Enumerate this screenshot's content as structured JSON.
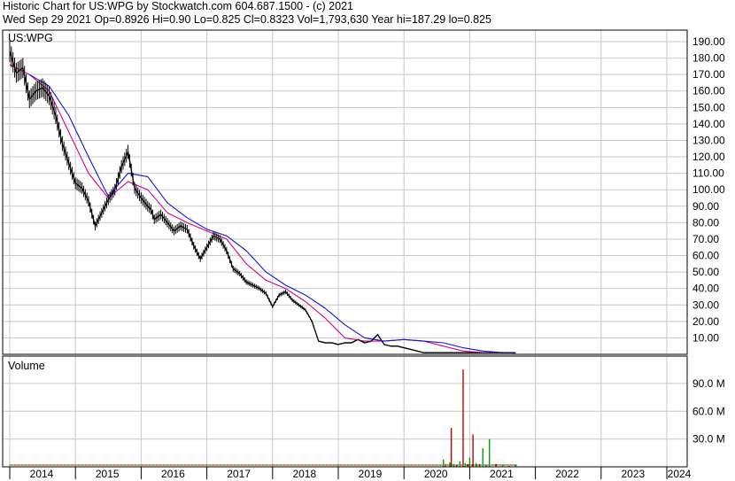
{
  "header": {
    "line1": "Historic Chart for US:WPG by Stockwatch.com 604.687.1500 - (c) 2021",
    "line2": "Wed Sep 29 2021   Op=0.8926   Hi=0.90   Lo=0.825   Cl=0.8323   Vol=1,793,630   Year hi=187.29   lo=0.825"
  },
  "chart_data": [
    {
      "type": "line",
      "title": "US:WPG",
      "ylim": [
        0,
        197
      ],
      "y_ticks": [
        "10.00",
        "20.00",
        "30.00",
        "40.00",
        "50.00",
        "60.00",
        "70.00",
        "80.00",
        "90.00",
        "100.00",
        "110.00",
        "120.00",
        "130.00",
        "140.00",
        "150.00",
        "160.00",
        "170.00",
        "180.00",
        "190.00"
      ],
      "x_tick_labels": [
        "2014",
        "2015",
        "2016",
        "2017",
        "2018",
        "2019",
        "2020",
        "2021",
        "2022",
        "2023",
        "2024"
      ],
      "grid": true,
      "series": [
        {
          "x": [
            2014.0,
            2014.1,
            2014.2,
            2014.3,
            2014.4,
            2014.5,
            2014.6,
            2014.7,
            2014.8,
            2014.9,
            2015.0,
            2015.1,
            2015.2,
            2015.3,
            2015.4,
            2015.5,
            2015.6,
            2015.7,
            2015.8,
            2015.9,
            2016.0,
            2016.1,
            2016.15,
            2016.2,
            2016.3,
            2016.4,
            2016.5,
            2016.6,
            2016.7,
            2016.8,
            2016.9,
            2017.0,
            2017.1,
            2017.2,
            2017.3,
            2017.4,
            2017.5,
            2017.6,
            2017.7,
            2017.8,
            2017.9,
            2018.0,
            2018.1,
            2018.2,
            2018.3,
            2018.4,
            2018.5,
            2018.6,
            2018.7,
            2018.8,
            2018.9,
            2019.0,
            2019.1,
            2019.2,
            2019.3,
            2019.4,
            2019.5,
            2019.6,
            2019.7,
            2019.8,
            2019.9,
            2020.0,
            2020.1,
            2020.2,
            2020.3,
            2020.4,
            2020.5,
            2020.6,
            2020.7,
            2020.8,
            2020.9,
            2021.0,
            2021.1,
            2021.2,
            2021.3,
            2021.4,
            2021.5,
            2021.6,
            2021.7
          ],
          "y": [
            184,
            171,
            174,
            155,
            160,
            162,
            157,
            145,
            128,
            116,
            104,
            101,
            93,
            78,
            86,
            94,
            100,
            114,
            123,
            101,
            95,
            90,
            88,
            82,
            85,
            80,
            75,
            78,
            76,
            66,
            58,
            65,
            72,
            70,
            63,
            52,
            49,
            44,
            42,
            40,
            37,
            29,
            36,
            38,
            33,
            30,
            27,
            20,
            8,
            7,
            7,
            6,
            7,
            7,
            9,
            7,
            8,
            12,
            6,
            5,
            5,
            4,
            3,
            2,
            1,
            1,
            1,
            1,
            1,
            1,
            1,
            1,
            1,
            1,
            1,
            1,
            1,
            1,
            0.83
          ]
        },
        {
          "x": [
            2014.0,
            2014.3,
            2014.6,
            2014.9,
            2015.2,
            2015.5,
            2015.8,
            2016.1,
            2016.4,
            2016.7,
            2017.0,
            2017.3,
            2017.6,
            2017.9,
            2018.2,
            2018.5,
            2018.8,
            2019.1,
            2019.4,
            2019.7,
            2020.0,
            2020.3,
            2020.6,
            2020.9,
            2021.2,
            2021.5,
            2021.7
          ],
          "y": [
            176,
            170,
            160,
            135,
            110,
            95,
            105,
            100,
            86,
            80,
            75,
            70,
            55,
            45,
            40,
            32,
            22,
            10,
            8,
            8,
            9,
            8,
            5,
            2,
            1,
            1,
            0.9
          ]
        },
        {
          "x": [
            2014.3,
            2014.6,
            2014.9,
            2015.2,
            2015.5,
            2015.8,
            2016.1,
            2016.4,
            2016.7,
            2017.0,
            2017.3,
            2017.6,
            2017.9,
            2018.2,
            2018.5,
            2018.8,
            2019.1,
            2019.4,
            2019.7,
            2020.0,
            2020.3,
            2020.6,
            2020.9,
            2021.2,
            2021.5,
            2021.7
          ],
          "y": [
            170,
            163,
            145,
            120,
            96,
            110,
            108,
            92,
            83,
            76,
            72,
            63,
            50,
            42,
            36,
            28,
            18,
            10,
            8,
            9,
            8,
            7,
            4,
            2,
            1,
            1
          ]
        }
      ]
    },
    {
      "type": "bar",
      "title": "Volume",
      "ylim": [
        0,
        110
      ],
      "y_ticks": [
        "30.0 M",
        "60.0 M",
        "90.0 M"
      ],
      "series": [
        {
          "x": [
            2020.6,
            2020.63,
            2020.7,
            2020.72,
            2020.76,
            2020.8,
            2020.85,
            2020.9,
            2020.93,
            2020.97,
            2021.0,
            2021.05,
            2021.1,
            2021.15,
            2021.2,
            2021.25,
            2021.3,
            2021.4,
            2021.5,
            2021.6,
            2021.7
          ],
          "values": [
            8,
            3,
            5,
            42,
            3,
            2,
            6,
            105,
            4,
            3,
            10,
            35,
            4,
            3,
            20,
            2,
            30,
            3,
            2,
            1,
            2
          ]
        }
      ]
    }
  ]
}
